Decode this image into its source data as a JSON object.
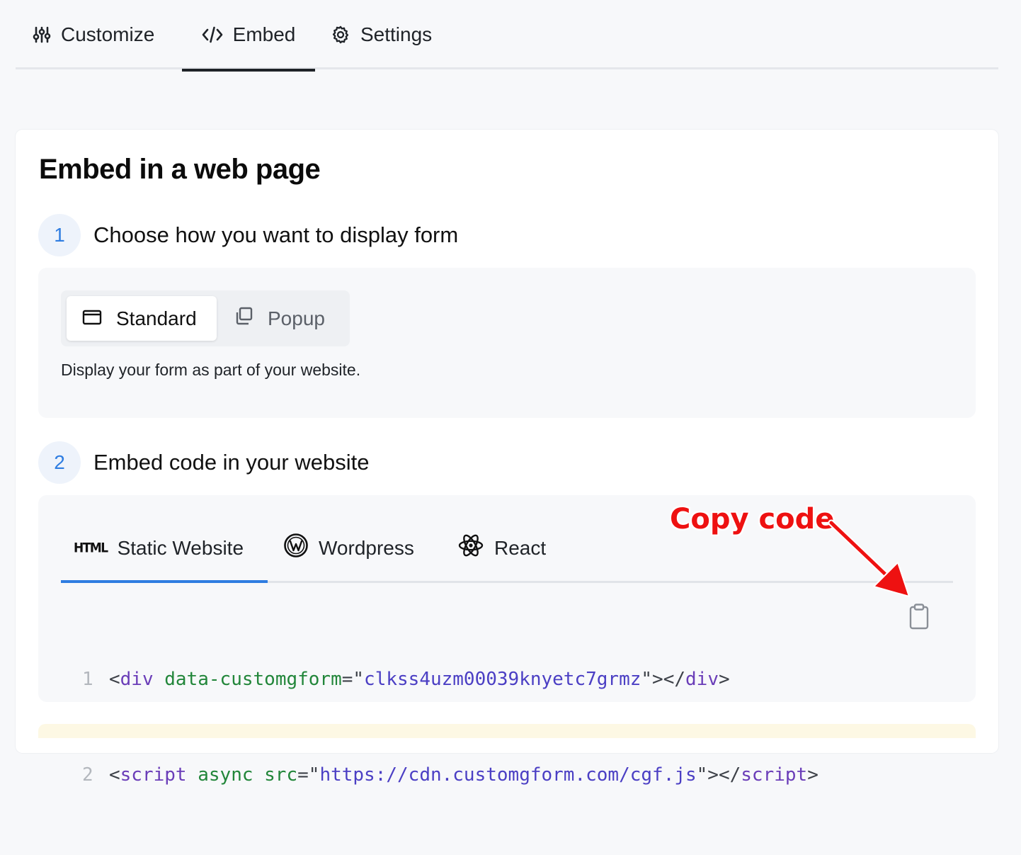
{
  "top_tabs": {
    "customize": "Customize",
    "embed": "Embed",
    "settings": "Settings"
  },
  "card": {
    "title": "Embed in a web page"
  },
  "step1": {
    "number": "1",
    "title": "Choose how you want to display form",
    "options": {
      "standard": "Standard",
      "popup": "Popup"
    },
    "selected": "Standard",
    "description": "Display your form as part of your website."
  },
  "step2": {
    "number": "2",
    "title": "Embed code in your website",
    "tabs": {
      "static_icon_text": "HTML",
      "static": "Static Website",
      "wordpress": "Wordpress",
      "react": "React"
    },
    "active_tab": "Static Website",
    "code": {
      "line1": {
        "num": "1",
        "open": "<",
        "tag": "div",
        "attr": "data-customgform",
        "eq": "=\"",
        "value": "clkss4uzm00039knyetc7grmz",
        "close_quote": "\"></",
        "close_tag": "div",
        "end": ">"
      },
      "line2": {
        "num": "2",
        "open": "<",
        "tag": "script",
        "attr": "async src",
        "eq": "=\"",
        "value": "https://cdn.customgform.com/cgf.js",
        "close_quote": "\"></",
        "close_tag": "script",
        "end": ">"
      }
    }
  },
  "annotation": {
    "text": "Copy code"
  },
  "colors": {
    "accent": "#2f7de1",
    "annotation": "#ee1111",
    "code_tag": "#6a3db8",
    "code_attr": "#22863a",
    "code_string": "#4b3fc4"
  }
}
